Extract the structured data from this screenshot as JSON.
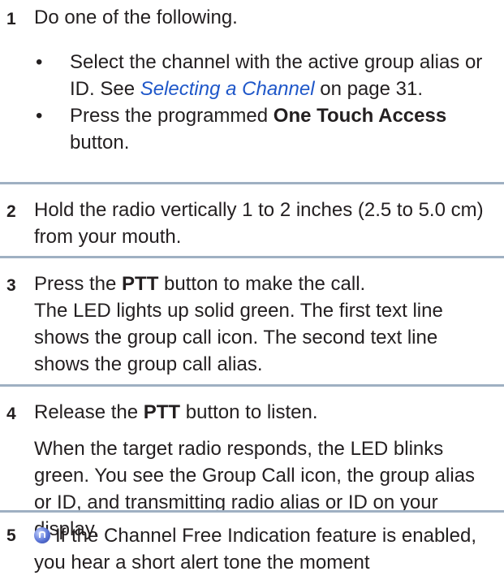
{
  "steps": [
    {
      "number": "1",
      "intro": "Do one of the following.",
      "bullets": [
        {
          "marker": "•",
          "text_before": "Select the channel with the active group alias or ID. See ",
          "link": "Selecting a Channel",
          "text_after": " on page 31."
        },
        {
          "marker": "•",
          "text_before": "Press the programmed ",
          "bold": "One Touch Access",
          "text_after": " button."
        }
      ]
    },
    {
      "number": "2",
      "text": "Hold the radio vertically 1 to 2 inches (2.5 to 5.0 cm) from your mouth."
    },
    {
      "number": "3",
      "line1_before": "Press the ",
      "line1_bold": "PTT",
      "line1_after": " button to make the call.",
      "line2": "The LED lights up solid green. The first text line shows the group call icon. The second text line shows the group call alias."
    },
    {
      "number": "4",
      "line1_before": "Release the ",
      "line1_bold": "PTT",
      "line1_after": " button to listen.",
      "line2": "When the target radio responds, the LED blinks green. You see the Group Call icon, the group alias or ID, and transmitting radio alias or ID on your display."
    },
    {
      "number": "5",
      "icon": "feature-icon",
      "text": "If the Channel Free Indication feature is enabled, you hear a short alert tone the moment"
    }
  ],
  "colors": {
    "text": "#231f20",
    "link": "#1f57c9",
    "divider": "#9fb0c2"
  }
}
